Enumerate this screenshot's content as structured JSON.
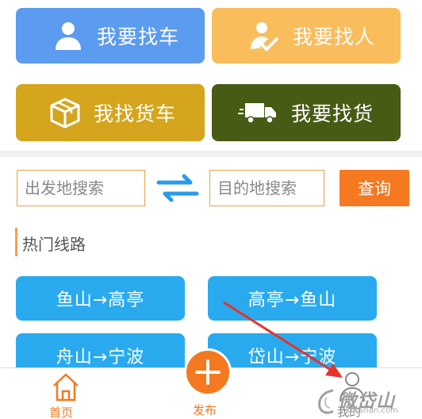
{
  "grid_buttons": {
    "find_car": "我要找车",
    "find_person": "我要找人",
    "find_truck": "我找货车",
    "find_goods": "我要找货"
  },
  "search": {
    "from_placeholder": "出发地搜索",
    "to_placeholder": "目的地搜索",
    "query_label": "查询"
  },
  "hot_routes": {
    "title": "热门线路",
    "routes": [
      "鱼山→高亭",
      "高亭→鱼山",
      "舟山→宁波",
      "岱山→宁波"
    ]
  },
  "tabbar": {
    "home_label": "首页",
    "publish_label": "发布",
    "mine_label": "我的"
  },
  "watermark": {
    "text": "微岱山",
    "url": "daishan.com"
  },
  "colors": {
    "accent_orange": "#f47920",
    "find_car_blue": "#5b9bf0",
    "find_person_yellow": "#f9bd5b",
    "find_truck_gold": "#d4a51d",
    "find_goods_olive": "#475b14",
    "route_blue": "#29aaee",
    "annotation_red": "#e8322b"
  },
  "icons": {
    "find_car": "person-icon",
    "find_person": "person-check-icon",
    "find_truck": "box-icon",
    "find_goods": "truck-icon",
    "swap": "swap-arrows-icon",
    "home": "house-icon",
    "publish": "plus-icon",
    "mine": "user-outline-icon"
  }
}
